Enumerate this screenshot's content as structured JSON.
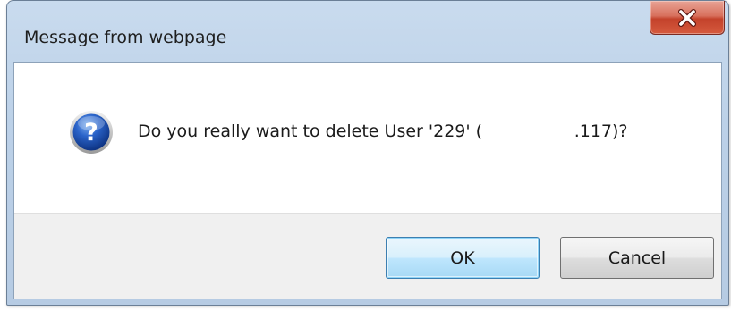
{
  "window": {
    "title": "Message from webpage",
    "close_icon": "close-icon"
  },
  "message": {
    "icon": "question-icon",
    "text": "Do you really want to delete User '229' (                 .117)?"
  },
  "buttons": {
    "ok_label": "OK",
    "cancel_label": "Cancel"
  },
  "colors": {
    "close_button": "#c4422b",
    "icon_blue": "#1f56b8",
    "default_button_border": "#3c7fb1"
  }
}
